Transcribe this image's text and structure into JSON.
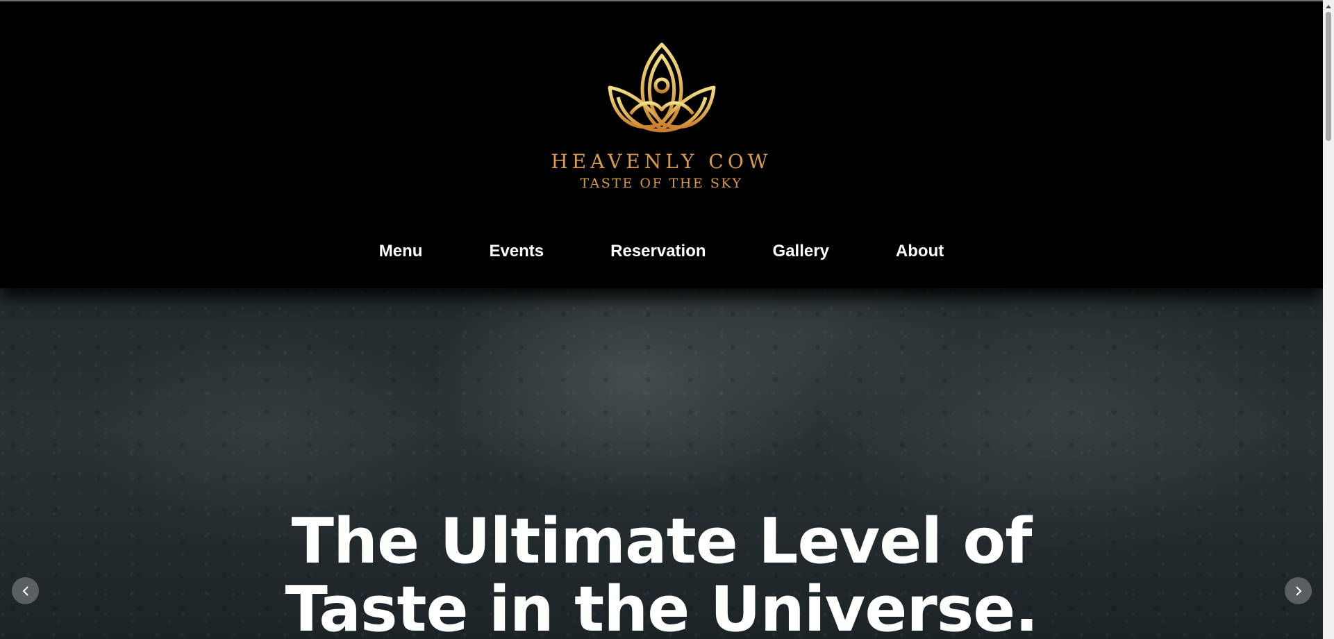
{
  "brand": {
    "name": "HEAVENLY COW",
    "tagline": "TASTE OF THE SKY",
    "logo_icon": "lotus-icon",
    "gold": "#d89a4c"
  },
  "nav": {
    "items": [
      {
        "label": "Menu"
      },
      {
        "label": "Events"
      },
      {
        "label": "Reservation"
      },
      {
        "label": "Gallery"
      },
      {
        "label": "About"
      }
    ]
  },
  "hero": {
    "heading_line1": "The Ultimate Level of",
    "heading_line2": "Taste in the Universe.",
    "prev_icon": "chevron-left-icon",
    "next_icon": "chevron-right-icon"
  },
  "colors": {
    "header_bg": "#000000",
    "text": "#ffffff"
  }
}
